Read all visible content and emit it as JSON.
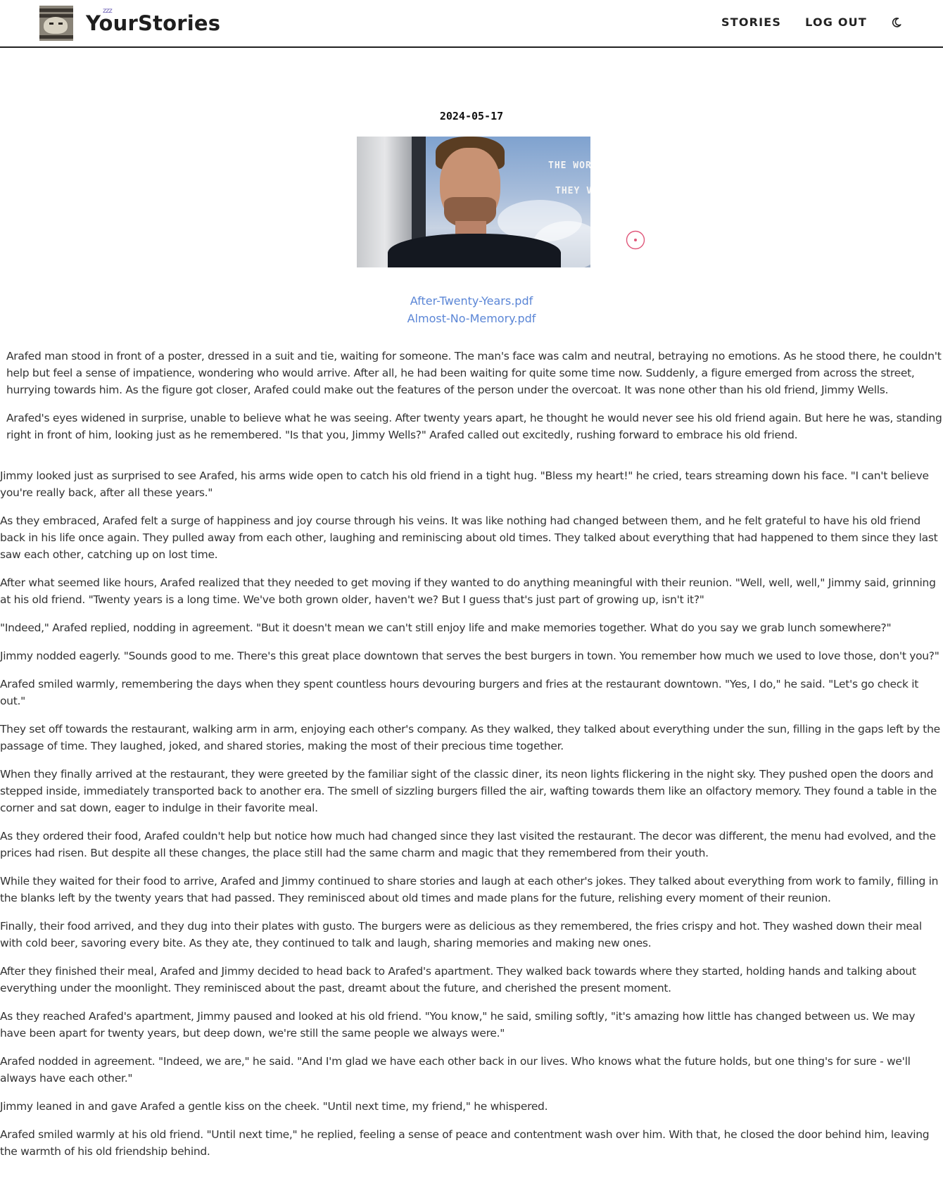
{
  "header": {
    "brand": "YourStories",
    "logo_badge": "zzz",
    "nav": [
      {
        "label": "STORIES"
      },
      {
        "label": "LOG OUT"
      }
    ],
    "theme_toggle_icon": "moon-icon"
  },
  "post": {
    "date": "2024-05-17",
    "photo_sign_lines": [
      "THE WOR",
      "THEY V"
    ],
    "files": [
      {
        "label": "After-Twenty-Years.pdf"
      },
      {
        "label": "Almost-No-Memory.pdf"
      }
    ],
    "paragraphs": [
      "Arafed man stood in front of a poster, dressed in a suit and tie, waiting for someone. The man's face was calm and neutral, betraying no emotions. As he stood there, he couldn't help but feel a sense of impatience, wondering who would arrive. After all, he had been waiting for quite some time now. Suddenly, a figure emerged from across the street, hurrying towards him. As the figure got closer, Arafed could make out the features of the person under the overcoat. It was none other than his old friend, Jimmy Wells.",
      "Arafed's eyes widened in surprise, unable to believe what he was seeing. After twenty years apart, he thought he would never see his old friend again. But here he was, standing right in front of him, looking just as he remembered. \"Is that you, Jimmy Wells?\" Arafed called out excitedly, rushing forward to embrace his old friend.",
      "Jimmy looked just as surprised to see Arafed, his arms wide open to catch his old friend in a tight hug. \"Bless my heart!\" he cried, tears streaming down his face. \"I can't believe you're really back, after all these years.\"",
      "As they embraced, Arafed felt a surge of happiness and joy course through his veins. It was like nothing had changed between them, and he felt grateful to have his old friend back in his life once again. They pulled away from each other, laughing and reminiscing about old times. They talked about everything that had happened to them since they last saw each other, catching up on lost time.",
      "After what seemed like hours, Arafed realized that they needed to get moving if they wanted to do anything meaningful with their reunion. \"Well, well, well,\" Jimmy said, grinning at his old friend. \"Twenty years is a long time. We've both grown older, haven't we? But I guess that's just part of growing up, isn't it?\"",
      "\"Indeed,\" Arafed replied, nodding in agreement. \"But it doesn't mean we can't still enjoy life and make memories together. What do you say we grab lunch somewhere?\"",
      "Jimmy nodded eagerly. \"Sounds good to me. There's this great place downtown that serves the best burgers in town. You remember how much we used to love those, don't you?\"",
      "Arafed smiled warmly, remembering the days when they spent countless hours devouring burgers and fries at the restaurant downtown. \"Yes, I do,\" he said. \"Let's go check it out.\"",
      "They set off towards the restaurant, walking arm in arm, enjoying each other's company. As they walked, they talked about everything under the sun, filling in the gaps left by the passage of time. They laughed, joked, and shared stories, making the most of their precious time together.",
      "When they finally arrived at the restaurant, they were greeted by the familiar sight of the classic diner, its neon lights flickering in the night sky. They pushed open the doors and stepped inside, immediately transported back to another era. The smell of sizzling burgers filled the air, wafting towards them like an olfactory memory. They found a table in the corner and sat down, eager to indulge in their favorite meal.",
      "As they ordered their food, Arafed couldn't help but notice how much had changed since they last visited the restaurant. The decor was different, the menu had evolved, and the prices had risen. But despite all these changes, the place still had the same charm and magic that they remembered from their youth.",
      "While they waited for their food to arrive, Arafed and Jimmy continued to share stories and laugh at each other's jokes. They talked about everything from work to family, filling in the blanks left by the twenty years that had passed. They reminisced about old times and made plans for the future, relishing every moment of their reunion.",
      "Finally, their food arrived, and they dug into their plates with gusto. The burgers were as delicious as they remembered, the fries crispy and hot. They washed down their meal with cold beer, savoring every bite. As they ate, they continued to talk and laugh, sharing memories and making new ones.",
      "After they finished their meal, Arafed and Jimmy decided to head back to Arafed's apartment. They walked back towards where they started, holding hands and talking about everything under the moonlight. They reminisced about the past, dreamt about the future, and cherished the present moment.",
      "As they reached Arafed's apartment, Jimmy paused and looked at his old friend. \"You know,\" he said, smiling softly, \"it's amazing how little has changed between us. We may have been apart for twenty years, but deep down, we're still the same people we always were.\"",
      "Arafed nodded in agreement. \"Indeed, we are,\" he said. \"And I'm glad we have each other back in our lives. Who knows what the future holds, but one thing's for sure - we'll always have each other.\"",
      "Jimmy leaned in and gave Arafed a gentle kiss on the cheek. \"Until next time, my friend,\" he whispered.",
      "Arafed smiled warmly at his old friend. \"Until next time,\" he replied, feeling a sense of peace and contentment wash over him. With that, he closed the door behind him, leaving the warmth of his old friendship behind."
    ]
  },
  "colors": {
    "link": "#5b86d6",
    "accent_target": "#e0577a",
    "text": "#333333",
    "header_rule": "#222222"
  }
}
